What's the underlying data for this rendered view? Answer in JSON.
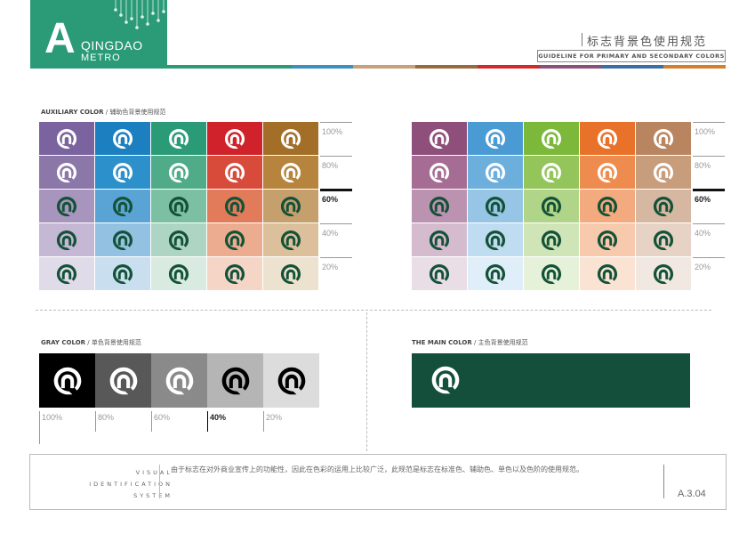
{
  "brand": {
    "letter": "A",
    "line1": "QINGDAO",
    "line2": "METRO",
    "bg_color": "#2a9a77"
  },
  "header": {
    "title_cn": "标志背景色使用规范",
    "title_en": "GUIDELINE FOR PRIMARY AND SECONDARY COLORS",
    "color_strip": [
      "#2a9a77",
      "#2a9a77",
      "#3d8fbf",
      "#c9a07a",
      "#9a6a3a",
      "#d22a2a",
      "#8a4f7a",
      "#3a6ea5",
      "#d47f2a"
    ]
  },
  "auxiliary": {
    "label_en": "AUXILIARY COLOR",
    "label_cn": "/ 辅助色背景使用规范",
    "left_colors": [
      [
        "#7a639e",
        "#1b7fc0",
        "#2a9a77",
        "#d0222a",
        "#a36e28"
      ],
      [
        "#8c77a9",
        "#2c90ca",
        "#4fab88",
        "#d84a3a",
        "#b6843c"
      ],
      [
        "#a795bd",
        "#5aa4d5",
        "#7cc0a3",
        "#e27b5a",
        "#c5a06c"
      ],
      [
        "#c4b8d4",
        "#93c1e1",
        "#aed5c3",
        "#ecac8f",
        "#dcc09c"
      ],
      [
        "#e0dbe9",
        "#c9deee",
        "#d9eae1",
        "#f5d6c6",
        "#ede2cf"
      ]
    ],
    "right_colors": [
      [
        "#8e4f7a",
        "#4a9bd4",
        "#7cb83a",
        "#e8722a",
        "#b98561"
      ],
      [
        "#a66d94",
        "#6cafdc",
        "#93c55b",
        "#ee8c4f",
        "#c79d7c"
      ],
      [
        "#bb93b0",
        "#97c5e6",
        "#b0d588",
        "#f3aa7e",
        "#d6b7a1"
      ],
      [
        "#d4bcce",
        "#c0dcf0",
        "#cfe5b7",
        "#f7caae",
        "#e6d3c5"
      ],
      [
        "#e9dde6",
        "#dfeef8",
        "#e6f1da",
        "#fbe3d4",
        "#f1e8e1"
      ]
    ],
    "logo_colors": [
      "#ffffff",
      "#ffffff",
      "#145238",
      "#145238",
      "#145238"
    ],
    "scale_labels": [
      "100%",
      "80%",
      "60%",
      "40%",
      "20%"
    ],
    "active_index": 2
  },
  "gray": {
    "label_en": "GRAY COLOR",
    "label_cn": "/ 单色背景使用规范",
    "colors": [
      "#000000",
      "#585858",
      "#8a8a8a",
      "#b5b5b5",
      "#dcdcdc"
    ],
    "logo_colors": [
      "#ffffff",
      "#ffffff",
      "#ffffff",
      "#000000",
      "#000000"
    ],
    "scale_labels": [
      "100%",
      "80%",
      "60%",
      "40%",
      "20%"
    ],
    "active_index": 3
  },
  "main_color": {
    "label_en": "THE MAIN COLOR",
    "label_cn": "/ 主色背景使用规范",
    "color": "#134f3b",
    "logo_color": "#ffffff"
  },
  "footer": {
    "vis_lines": [
      "VISUAL",
      "IDENTIFICATION",
      "SYSTEM"
    ],
    "description": "由于标志在对外商业宣传上的功能性，因此在色彩的运用上比较广泛，此规范是标志在标准色、辅助色、单色以及色阶的使用规范。",
    "page_number": "A.3.04"
  }
}
